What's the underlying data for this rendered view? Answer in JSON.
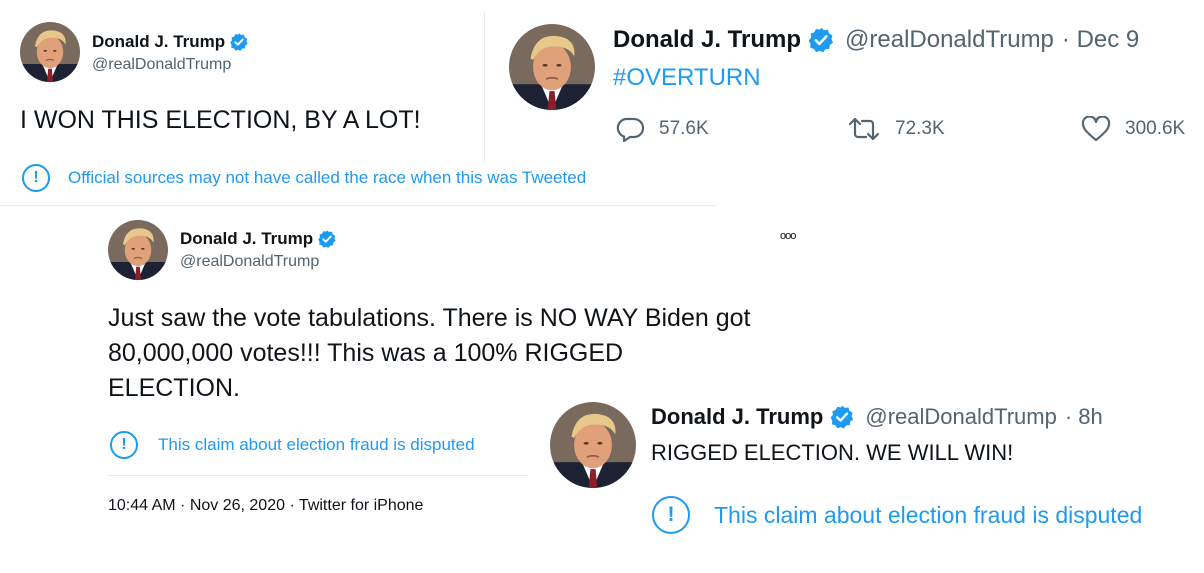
{
  "colors": {
    "accent": "#1d9bf0",
    "text": "#0f1419",
    "muted": "#536471",
    "divider": "#e6ecf0"
  },
  "tweet1": {
    "name": "Donald J. Trump",
    "handle": "@realDonaldTrump",
    "text": "I WON THIS ELECTION, BY A LOT!",
    "notice": "Official sources may not have called the race when this was Tweeted",
    "icons": [
      "avatar",
      "verified-badge-icon",
      "info-icon"
    ]
  },
  "tweet2": {
    "name": "Donald J. Trump",
    "handle": "@realDonaldTrump",
    "date": "· Dec 9",
    "text": "#OVERTURN",
    "replies": "57.6K",
    "retweets": "72.3K",
    "likes": "300.6K",
    "icons": [
      "avatar",
      "verified-badge-icon",
      "reply-icon",
      "retweet-icon",
      "like-icon"
    ]
  },
  "tweet3": {
    "name": "Donald J. Trump",
    "handle": "@realDonaldTrump",
    "more": "ooo",
    "text_lines": [
      "Just saw the vote tabulations. There is NO WAY Biden got",
      "80,000,000 votes!!! This was a 100% RIGGED",
      "ELECTION."
    ],
    "notice": "This claim about election fraud is disputed",
    "timestamp": "10:44 AM · Nov 26, 2020 · Twitter for iPhone",
    "icons": [
      "avatar",
      "verified-badge-icon",
      "more-options-icon",
      "info-icon"
    ]
  },
  "tweet4": {
    "name": "Donald J. Trump",
    "handle": "@realDonaldTrump",
    "time": "· 8h",
    "text": "RIGGED ELECTION. WE WILL WIN!",
    "notice": "This claim about election fraud is disputed",
    "icons": [
      "avatar",
      "verified-badge-icon",
      "info-icon"
    ]
  }
}
